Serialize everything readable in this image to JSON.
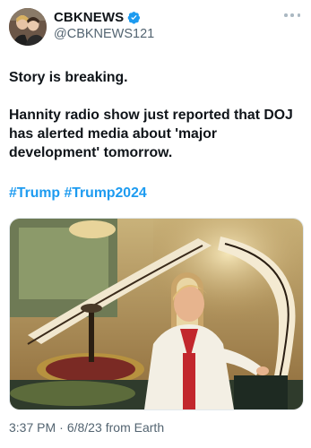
{
  "author": {
    "display_name": "CBKNEWS",
    "handle": "@CBKNEWS121",
    "verified_icon": "verified-badge-icon",
    "verified_color": "#1d9bf0"
  },
  "tweet": {
    "line1": "Story is breaking.",
    "line2": "Hannity radio show just reported that DOJ has alerted media about 'major development' tomorrow.",
    "hashtags": [
      "#Trump",
      "#Trump2024"
    ]
  },
  "meta": {
    "time": "3:37 PM",
    "separator1": "·",
    "date": "6/8/23",
    "source": "from Earth"
  },
  "colors": {
    "link": "#1d9bf0",
    "muted": "#536471",
    "text": "#0f1419"
  }
}
